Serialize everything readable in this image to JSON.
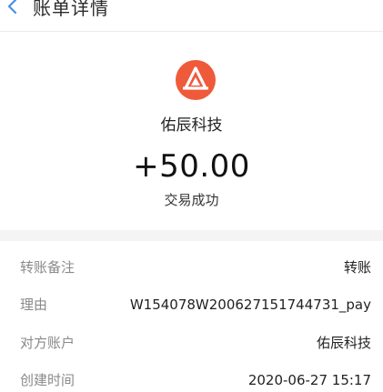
{
  "nav": {
    "title": "账单详情",
    "back_icon": "chevron-left-icon"
  },
  "header": {
    "logo_icon": "merchant-logo-icon",
    "merchant_name": "佑辰科技",
    "amount": "+50.00",
    "status": "交易成功"
  },
  "details": [
    {
      "label": "转账备注",
      "value": "转账"
    },
    {
      "label": "理由",
      "value": "W154078W200627151744731_pay"
    },
    {
      "label": "对方账户",
      "value": "佑辰科技"
    },
    {
      "label": "创建时间",
      "value": "2020-06-27 15:17"
    }
  ],
  "colors": {
    "accent": "#4a8fe7",
    "logo": "#ef5a3a",
    "section_bg": "#f4f4f4"
  }
}
